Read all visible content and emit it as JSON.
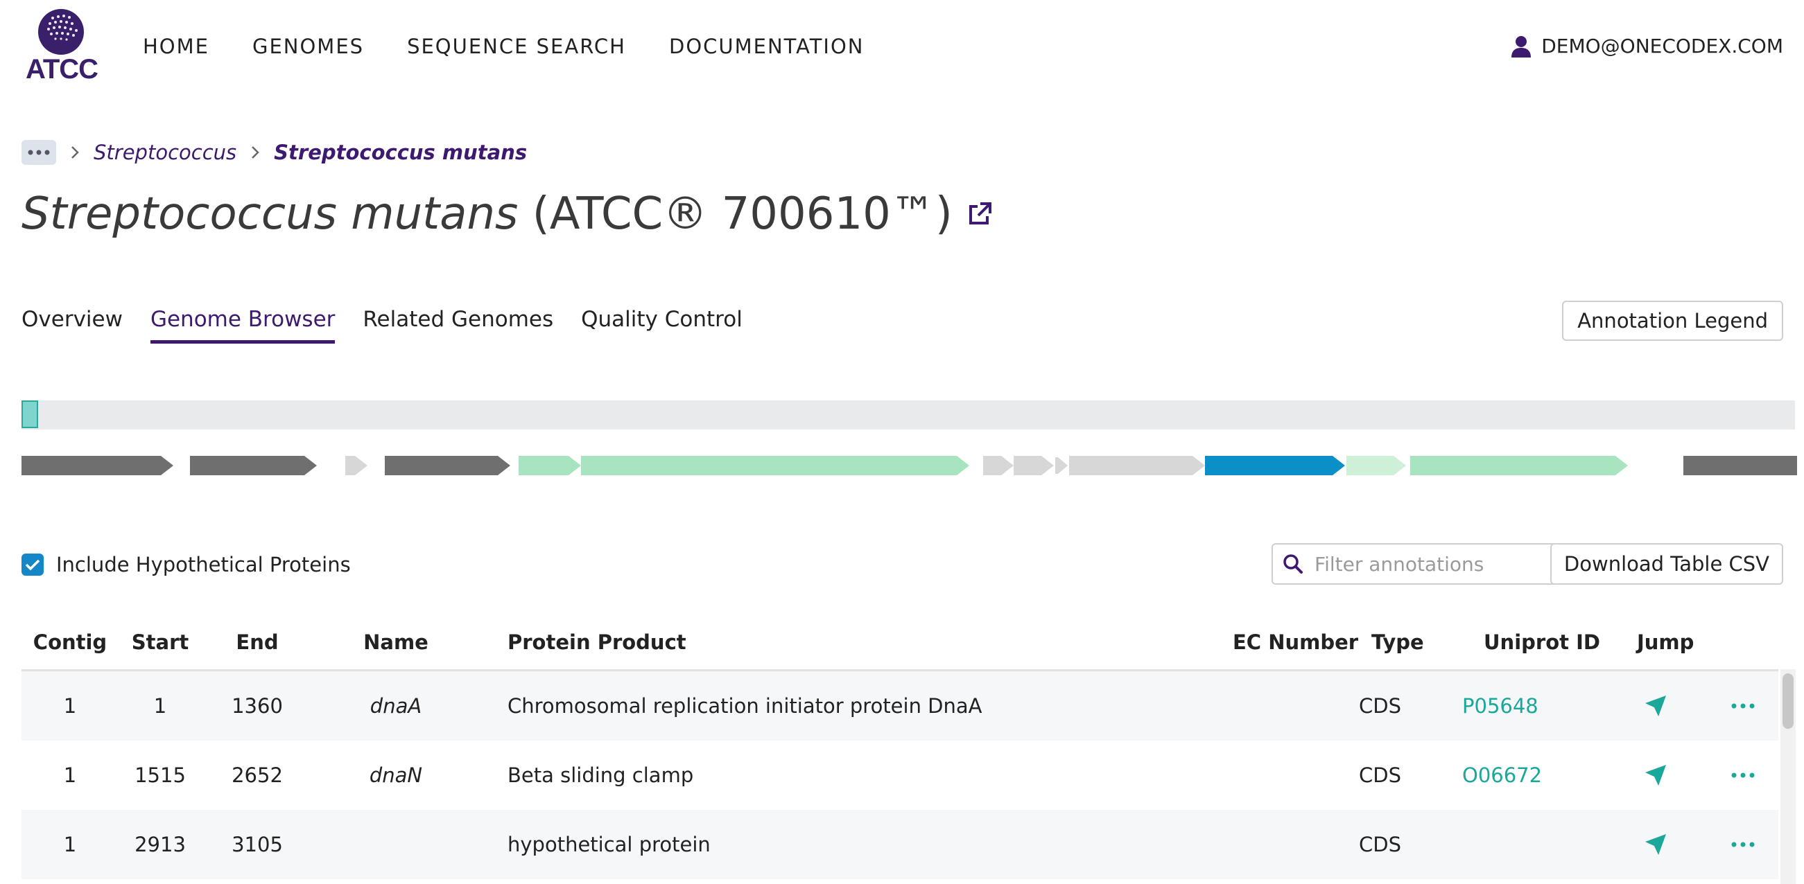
{
  "header": {
    "logo_text": "ATCC",
    "nav": [
      "HOME",
      "GENOMES",
      "SEQUENCE SEARCH",
      "DOCUMENTATION"
    ],
    "user_email": "DEMO@ONECODEX.COM"
  },
  "breadcrumb": {
    "genus": "Streptococcus",
    "species": "Streptococcus mutans"
  },
  "page": {
    "title_species": "Streptococcus mutans",
    "title_strain": "(ATCC® 700610™)"
  },
  "tabs": {
    "items": [
      "Overview",
      "Genome Browser",
      "Related Genomes",
      "Quality Control"
    ],
    "active": "Genome Browser",
    "legend_button": "Annotation Legend"
  },
  "track_colors": {
    "dark_gray": "#6f6f6f",
    "light_gray": "#d7d7d7",
    "green": "#a8e4bf",
    "light_green": "#cdf0d6",
    "blue": "#0b8fc6"
  },
  "controls": {
    "include_hypothetical_label": "Include Hypothetical Proteins",
    "include_hypothetical_checked": true,
    "filter_placeholder": "Filter annotations",
    "filter_value": "",
    "download_button": "Download Table CSV"
  },
  "table": {
    "columns": [
      "Contig",
      "Start",
      "End",
      "Name",
      "Protein Product",
      "EC Number",
      "Type",
      "Uniprot ID",
      "Jump"
    ],
    "rows": [
      {
        "contig": "1",
        "start": "1",
        "end": "1360",
        "name": "dnaA",
        "product": "Chromosomal replication initiator protein DnaA",
        "ec": "",
        "type": "CDS",
        "uniprot": "P05648"
      },
      {
        "contig": "1",
        "start": "1515",
        "end": "2652",
        "name": "dnaN",
        "product": "Beta sliding clamp",
        "ec": "",
        "type": "CDS",
        "uniprot": "O06672"
      },
      {
        "contig": "1",
        "start": "2913",
        "end": "3105",
        "name": "",
        "product": "hypothetical protein",
        "ec": "",
        "type": "CDS",
        "uniprot": ""
      }
    ]
  }
}
